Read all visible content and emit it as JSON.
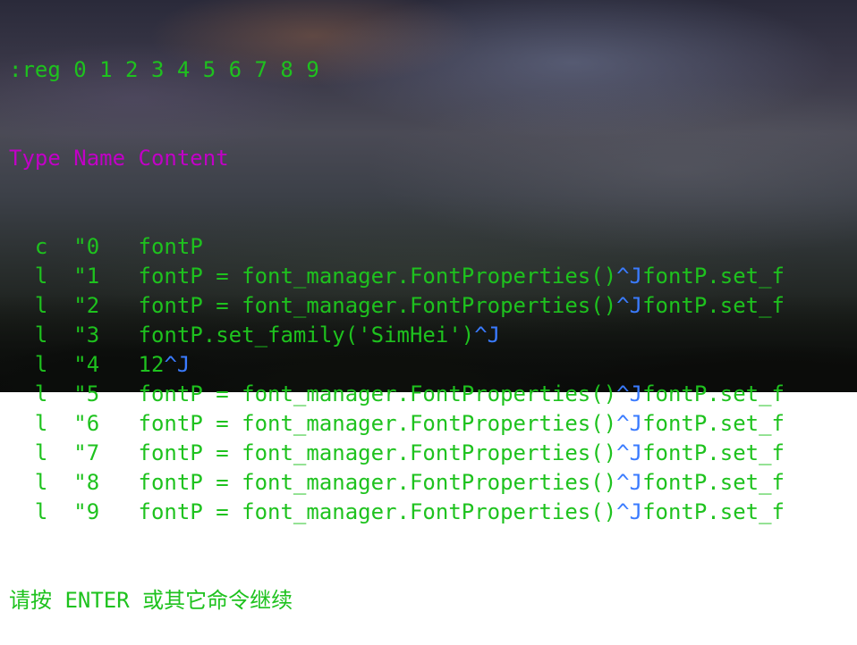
{
  "command_line": ":reg 0 1 2 3 4 5 6 7 8 9",
  "header": {
    "type": "Type",
    "name": "Name",
    "content": "Content"
  },
  "registers": [
    {
      "type": "c",
      "name": "\"0",
      "content": [
        {
          "text": "fontP",
          "ctrl": false
        }
      ]
    },
    {
      "type": "l",
      "name": "\"1",
      "content": [
        {
          "text": "fontP = font_manager.FontProperties()",
          "ctrl": false
        },
        {
          "text": "^J",
          "ctrl": true
        },
        {
          "text": "fontP.set_f",
          "ctrl": false
        }
      ]
    },
    {
      "type": "l",
      "name": "\"2",
      "content": [
        {
          "text": "fontP = font_manager.FontProperties()",
          "ctrl": false
        },
        {
          "text": "^J",
          "ctrl": true
        },
        {
          "text": "fontP.set_f",
          "ctrl": false
        }
      ]
    },
    {
      "type": "l",
      "name": "\"3",
      "content": [
        {
          "text": "fontP.set_family('SimHei')",
          "ctrl": false
        },
        {
          "text": "^J",
          "ctrl": true
        }
      ]
    },
    {
      "type": "l",
      "name": "\"4",
      "content": [
        {
          "text": "12",
          "ctrl": false
        },
        {
          "text": "^J",
          "ctrl": true
        }
      ]
    },
    {
      "type": "l",
      "name": "\"5",
      "content": [
        {
          "text": "fontP = font_manager.FontProperties()",
          "ctrl": false
        },
        {
          "text": "^J",
          "ctrl": true
        },
        {
          "text": "fontP.set_f",
          "ctrl": false
        }
      ]
    },
    {
      "type": "l",
      "name": "\"6",
      "content": [
        {
          "text": "fontP = font_manager.FontProperties()",
          "ctrl": false
        },
        {
          "text": "^J",
          "ctrl": true
        },
        {
          "text": "fontP.set_f",
          "ctrl": false
        }
      ]
    },
    {
      "type": "l",
      "name": "\"7",
      "content": [
        {
          "text": "fontP = font_manager.FontProperties()",
          "ctrl": false
        },
        {
          "text": "^J",
          "ctrl": true
        },
        {
          "text": "fontP.set_f",
          "ctrl": false
        }
      ]
    },
    {
      "type": "l",
      "name": "\"8",
      "content": [
        {
          "text": "fontP = font_manager.FontProperties()",
          "ctrl": false
        },
        {
          "text": "^J",
          "ctrl": true
        },
        {
          "text": "fontP.set_f",
          "ctrl": false
        }
      ]
    },
    {
      "type": "l",
      "name": "\"9",
      "content": [
        {
          "text": "fontP = font_manager.FontProperties()",
          "ctrl": false
        },
        {
          "text": "^J",
          "ctrl": true
        },
        {
          "text": "fontP.set_f",
          "ctrl": false
        }
      ]
    }
  ],
  "prompt": "请按 ENTER 或其它命令继续",
  "colors": {
    "text": "#1ec21e",
    "header": "#c100c6",
    "control_char": "#3a7bff"
  }
}
